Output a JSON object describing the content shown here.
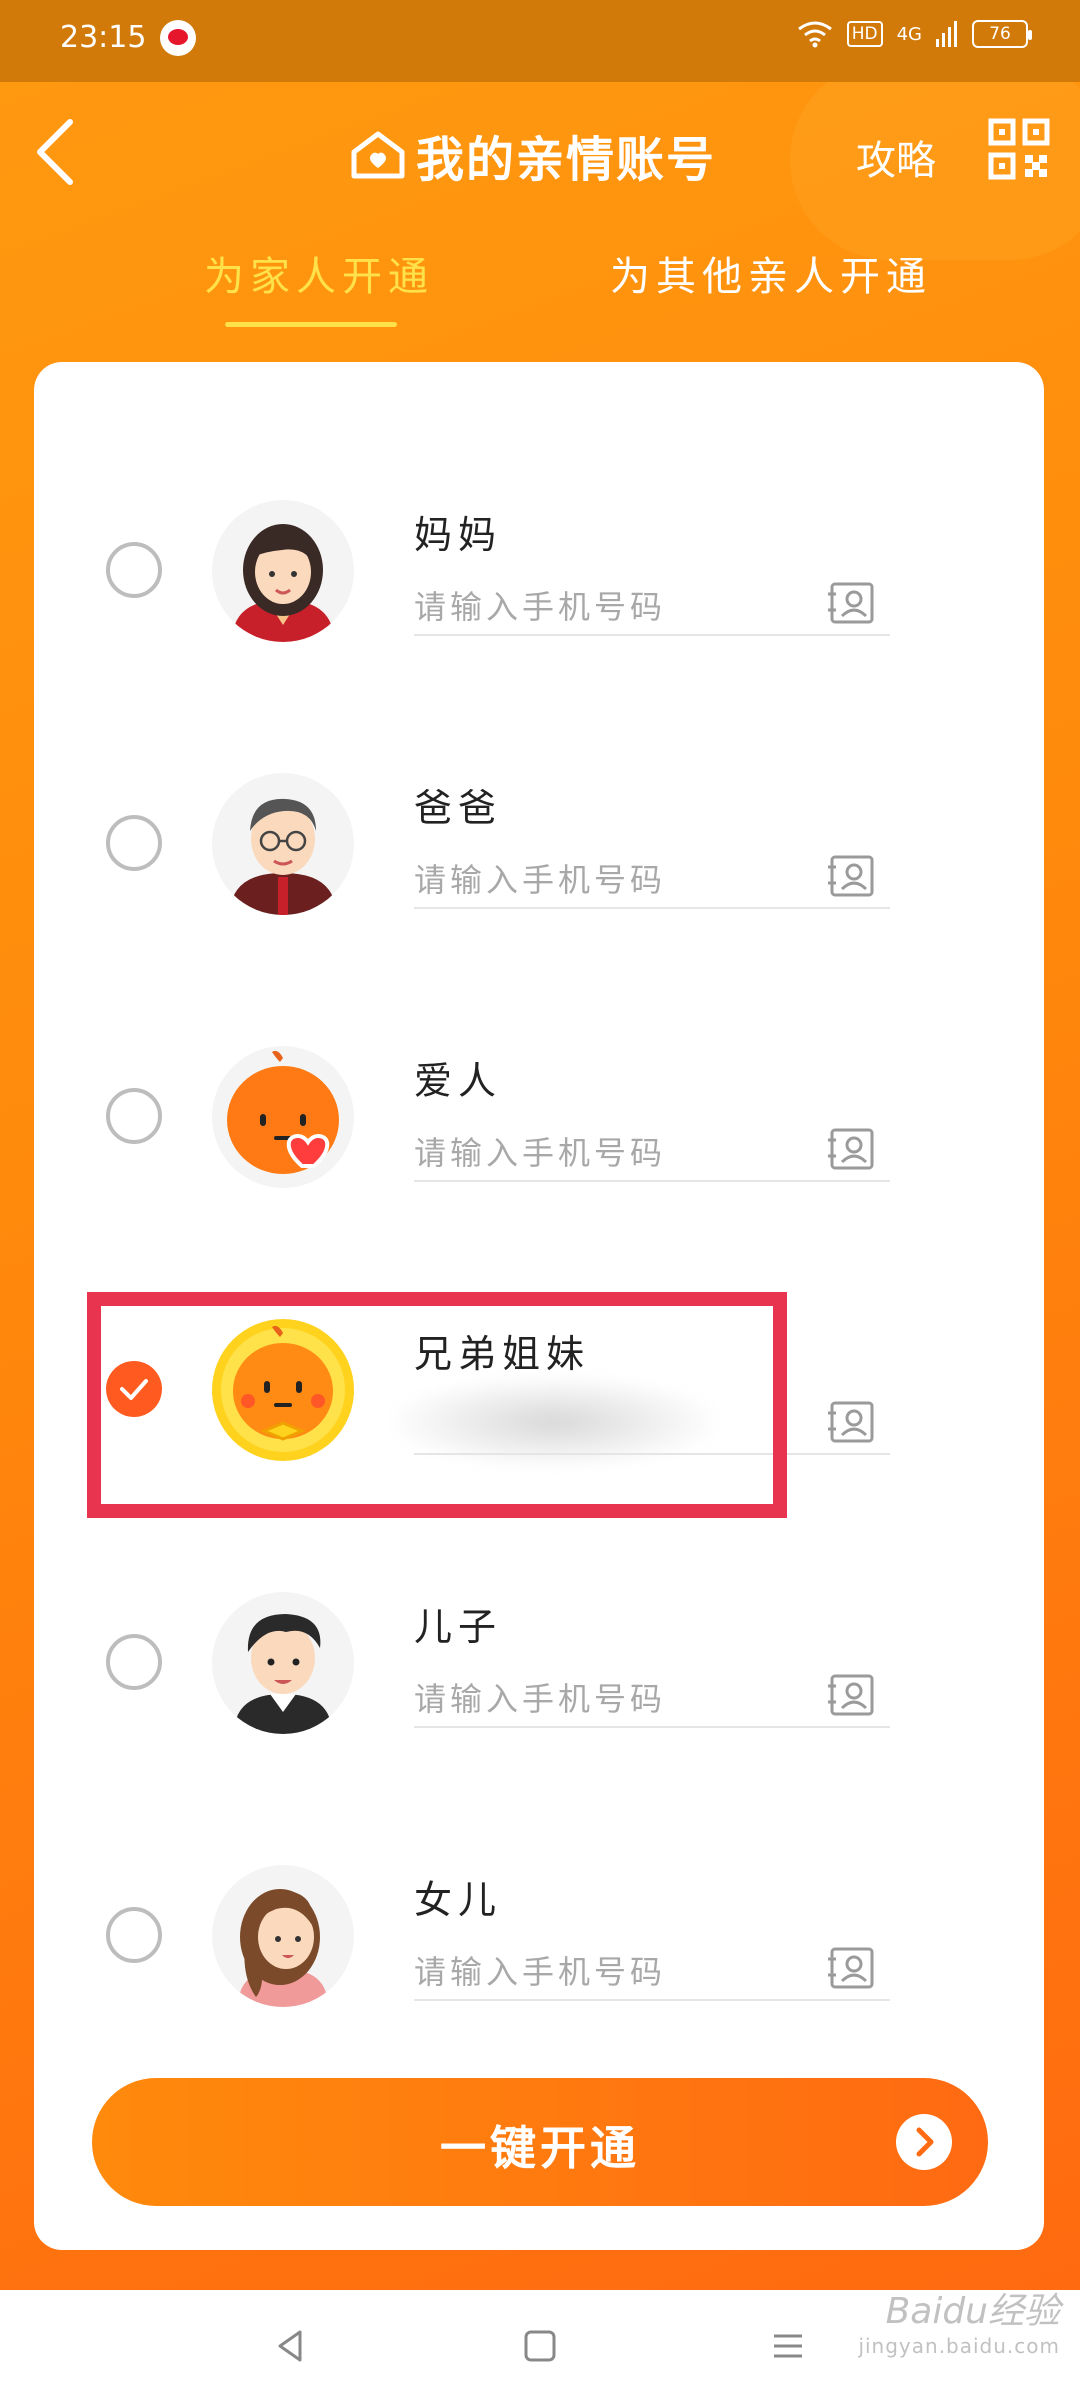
{
  "status_bar": {
    "time": "23:15",
    "hd": "HD",
    "network": "4G",
    "battery": "76"
  },
  "header": {
    "title": "我的亲情账号",
    "strategy_label": "攻略"
  },
  "tabs": [
    {
      "label": "为家人开通",
      "active": true
    },
    {
      "label": "为其他亲人开通",
      "active": false
    }
  ],
  "members": [
    {
      "name": "妈妈",
      "placeholder": "请输入手机号码",
      "selected": false
    },
    {
      "name": "爸爸",
      "placeholder": "请输入手机号码",
      "selected": false
    },
    {
      "name": "爱人",
      "placeholder": "请输入手机号码",
      "selected": false
    },
    {
      "name": "兄弟姐妹",
      "placeholder": "",
      "selected": true
    },
    {
      "name": "儿子",
      "placeholder": "请输入手机号码",
      "selected": false
    },
    {
      "name": "女儿",
      "placeholder": "请输入手机号码",
      "selected": false
    }
  ],
  "cta": {
    "label": "一键开通"
  },
  "watermark": {
    "brand": "Baidu经验",
    "url": "jingyan.baidu.com"
  },
  "colors": {
    "primary": "#ff8a0c",
    "accent": "#ff5a1f",
    "highlight": "#e8344e",
    "tab_active": "#ffe14a"
  }
}
